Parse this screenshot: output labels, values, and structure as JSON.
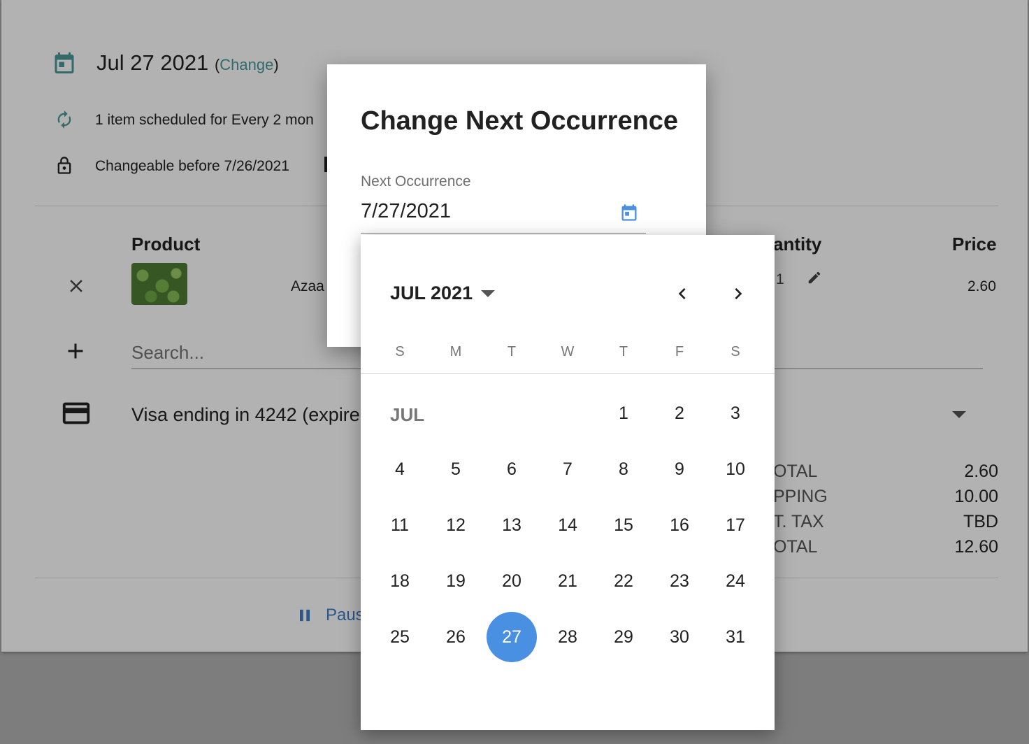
{
  "schedule": {
    "date": "Jul 27 2021",
    "change_open": "(",
    "change_link": "Change",
    "change_close": ")",
    "frequency_text": "1 item scheduled for Every 2 mon",
    "changeable_text": "Changeable before 7/26/2021"
  },
  "table": {
    "headers": {
      "product": "Product",
      "quantity": "antity",
      "price": "Price"
    },
    "rows": [
      {
        "name": "Azaa",
        "quantity": "1",
        "price": "2.60"
      }
    ]
  },
  "search": {
    "placeholder": "Search..."
  },
  "payment": {
    "text": "Visa ending in 4242 (expire"
  },
  "totals": [
    {
      "label": "OTAL",
      "value": "2.60"
    },
    {
      "label": "PPING",
      "value": "10.00"
    },
    {
      "label": "T. TAX",
      "value": "TBD"
    },
    {
      "label": "OTAL",
      "value": "12.60"
    }
  ],
  "footer": {
    "pause_label": "Paus"
  },
  "dialog": {
    "title": "Change Next Occurrence",
    "field_label": "Next Occurrence",
    "field_value": "7/27/2021"
  },
  "picker": {
    "month_year": "JUL 2021",
    "month_label": "JUL",
    "weekdays": [
      "S",
      "M",
      "T",
      "W",
      "T",
      "F",
      "S"
    ],
    "first_weekday_index": 4,
    "days": [
      "1",
      "2",
      "3",
      "4",
      "5",
      "6",
      "7",
      "8",
      "9",
      "10",
      "11",
      "12",
      "13",
      "14",
      "15",
      "16",
      "17",
      "18",
      "19",
      "20",
      "21",
      "22",
      "23",
      "24",
      "25",
      "26",
      "27",
      "28",
      "29",
      "30",
      "31"
    ],
    "selected_day": "27",
    "accent_color": "#4a90e2"
  },
  "colors": {
    "teal": "#4a9a9a",
    "link_blue": "#3d7cc9"
  }
}
